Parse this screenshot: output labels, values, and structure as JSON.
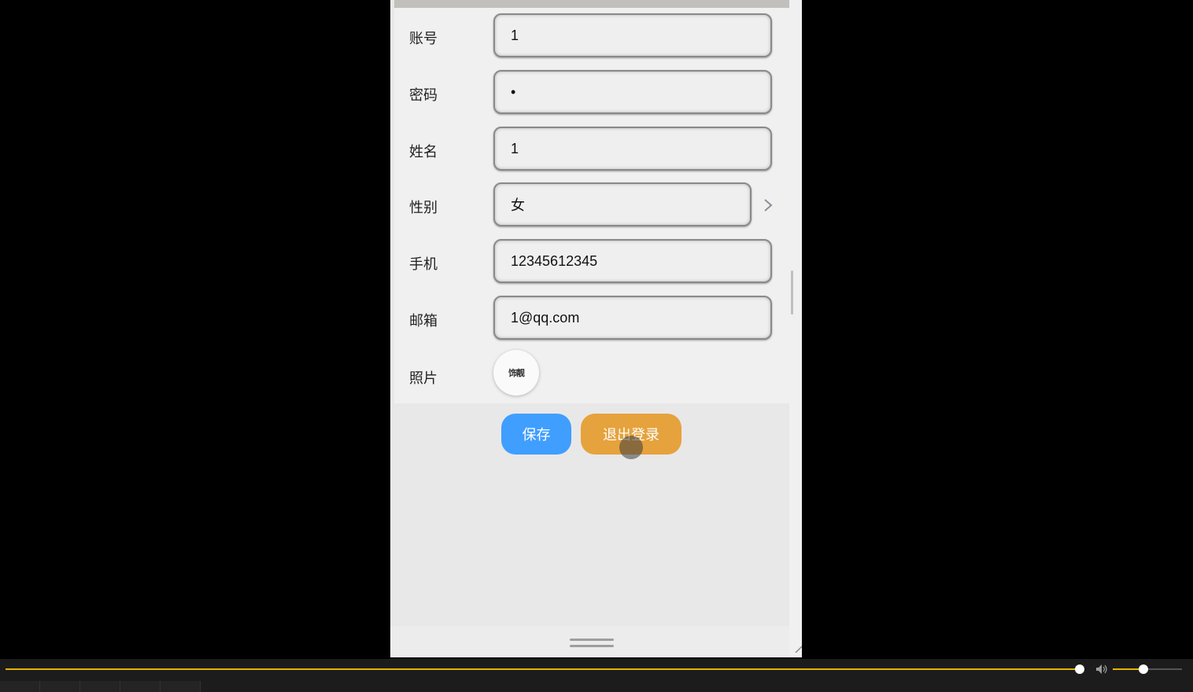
{
  "form": {
    "fields": [
      {
        "label": "账号",
        "value": "1"
      },
      {
        "label": "密码",
        "value": "•"
      },
      {
        "label": "姓名",
        "value": "1"
      },
      {
        "label": "性别",
        "value": "女"
      },
      {
        "label": "手机",
        "value": "12345612345"
      },
      {
        "label": "邮箱",
        "value": "1@qq.com"
      }
    ],
    "photo_label": "照片",
    "photo_text": "饰靓"
  },
  "buttons": {
    "save_label": "保存",
    "logout_label": "退出登录"
  },
  "colors": {
    "save": "#409eff",
    "logout": "#e6a23c",
    "seek": "#e5b400"
  },
  "player": {
    "progress": 0.995,
    "volume": 0.45
  }
}
